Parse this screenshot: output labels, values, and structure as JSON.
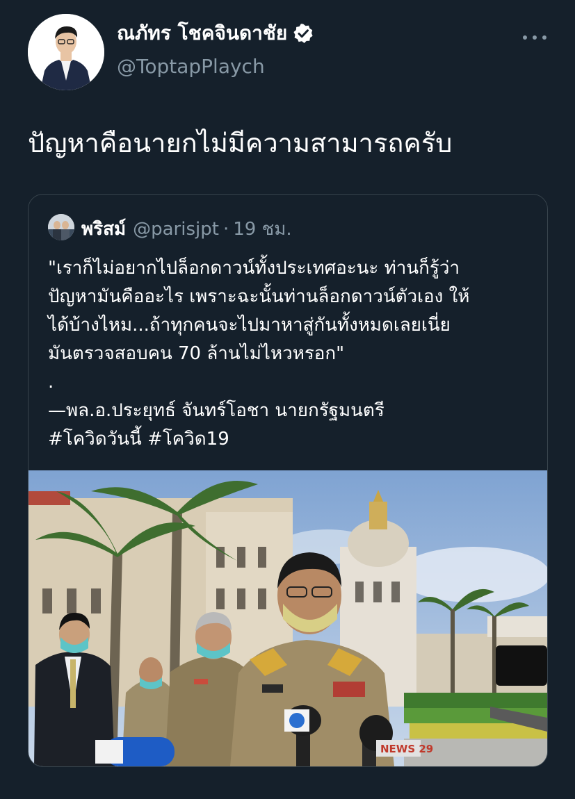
{
  "author": {
    "display_name": "ณภัทร โชคจินดาชัย",
    "handle": "@ToptapPlaych",
    "verified": true,
    "verified_icon": "verified-badge-icon"
  },
  "tweet": {
    "text": "ปัญหาคือนายกไม่มีความสามารถครับ"
  },
  "quoted": {
    "display_name": "พริสม์",
    "handle": "@parisjpt",
    "separator": "·",
    "time": "19 ชม.",
    "lines": [
      "\"เราก็ไม่อยากไปล็อกดาวน์ทั้งประเทศอะนะ ท่านก็รู้ว่า",
      "ปัญหามันคืออะไร เพราะฉะนั้นท่านล็อกดาวน์ตัวเอง ให้",
      "ได้บ้างไหม...ถ้าทุกคนจะไปมาหาสู่กันทั้งหมดเลยเนี่ย",
      "มันตรวจสอบคน 70 ล้านไม่ไหวหรอก\"",
      ".",
      "—พล.อ.ประยุทธ์ จันทร์โอชา นายกรัฐมนตรี",
      "#โควิดวันนี้ #โควิด19"
    ],
    "media_mic_label": "NEWS 29"
  },
  "colors": {
    "background": "#15202b",
    "text_primary": "#ffffff",
    "text_secondary": "#8899a6",
    "border": "#38444d",
    "verified_bg": "#ffffff"
  }
}
